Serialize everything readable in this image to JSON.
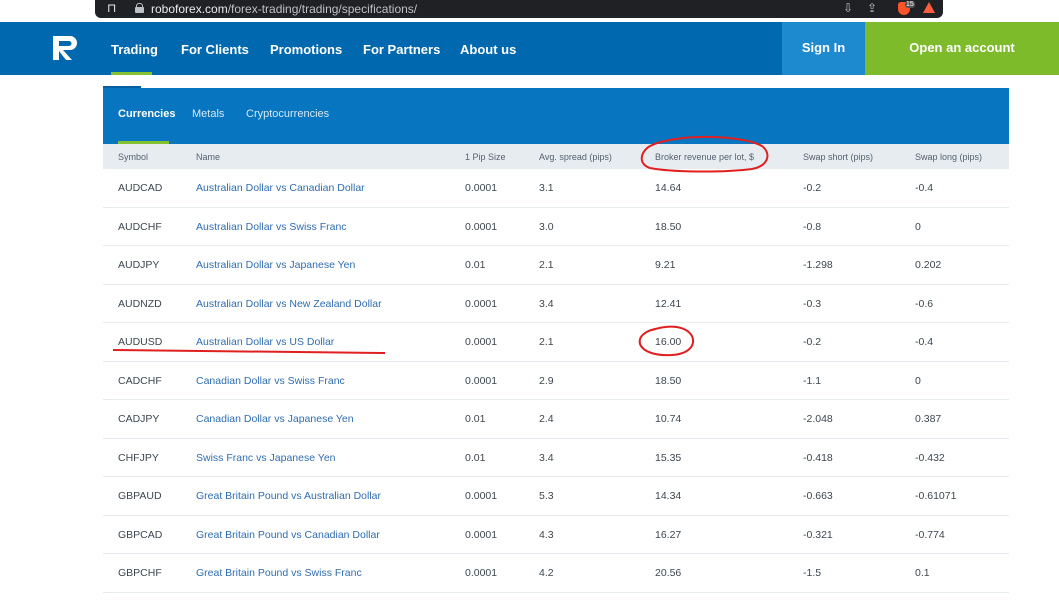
{
  "browser": {
    "url_host": "roboforex.com",
    "url_path": "/forex-trading/trading/specifications/",
    "brave_badge": "15"
  },
  "nav": {
    "logo": "R",
    "items": [
      "Trading",
      "For Clients",
      "Promotions",
      "For Partners",
      "About us"
    ],
    "active_item": "Trading",
    "sign_in": "Sign In",
    "open_account": "Open an account"
  },
  "tabs": {
    "items": [
      "Currencies",
      "Metals",
      "Cryptocurrencies"
    ],
    "active": "Currencies"
  },
  "table": {
    "headers": [
      "Symbol",
      "Name",
      "1 Pip Size",
      "Avg. spread (pips)",
      "Broker revenue per lot, $",
      "Swap short (pips)",
      "Swap long (pips)"
    ],
    "rows": [
      [
        "AUDCAD",
        "Australian Dollar vs Canadian Dollar",
        "0.0001",
        "3.1",
        "14.64",
        "-0.2",
        "-0.4"
      ],
      [
        "AUDCHF",
        "Australian Dollar vs Swiss Franc",
        "0.0001",
        "3.0",
        "18.50",
        "-0.8",
        "0"
      ],
      [
        "AUDJPY",
        "Australian Dollar vs Japanese Yen",
        "0.01",
        "2.1",
        "9.21",
        "-1.298",
        "0.202"
      ],
      [
        "AUDNZD",
        "Australian Dollar vs New Zealand Dollar",
        "0.0001",
        "3.4",
        "12.41",
        "-0.3",
        "-0.6"
      ],
      [
        "AUDUSD",
        "Australian Dollar vs US Dollar",
        "0.0001",
        "2.1",
        "16.00",
        "-0.2",
        "-0.4"
      ],
      [
        "CADCHF",
        "Canadian Dollar vs Swiss Franc",
        "0.0001",
        "2.9",
        "18.50",
        "-1.1",
        "0"
      ],
      [
        "CADJPY",
        "Canadian Dollar vs Japanese Yen",
        "0.01",
        "2.4",
        "10.74",
        "-2.048",
        "0.387"
      ],
      [
        "CHFJPY",
        "Swiss Franc vs Japanese Yen",
        "0.01",
        "3.4",
        "15.35",
        "-0.418",
        "-0.432"
      ],
      [
        "GBPAUD",
        "Great Britain Pound vs Australian Dollar",
        "0.0001",
        "5.3",
        "14.34",
        "-0.663",
        "-0.61071"
      ],
      [
        "GBPCAD",
        "Great Britain Pound vs Canadian Dollar",
        "0.0001",
        "4.3",
        "16.27",
        "-0.321",
        "-0.774"
      ],
      [
        "GBPCHF",
        "Great Britain Pound vs Swiss Franc",
        "0.0001",
        "4.2",
        "20.56",
        "-1.5",
        "0.1"
      ]
    ]
  },
  "colors": {
    "nav_bg": "#0068ae",
    "accent_green": "#85c232",
    "tab_band": "#0775bf",
    "link": "#2f6db1",
    "annotation_red": "#e02020"
  }
}
